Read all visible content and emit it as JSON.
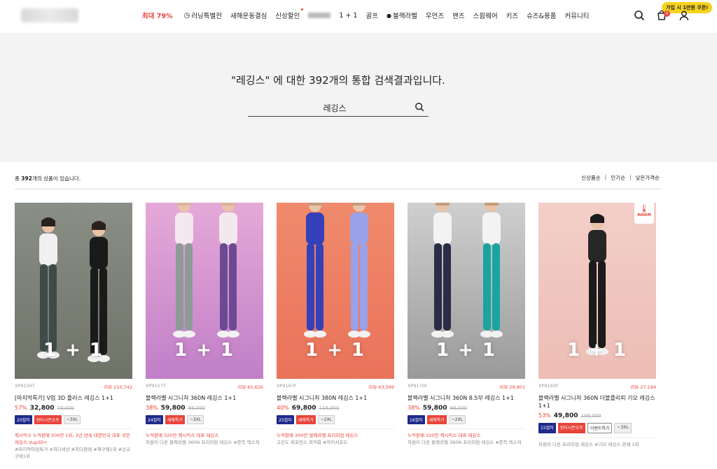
{
  "nav": {
    "items": [
      {
        "label": "최대 79%",
        "style": "sale"
      },
      {
        "label": "러닝특별전",
        "icon": "clock-icon"
      },
      {
        "label": "새해운동결심"
      },
      {
        "label": "신상할인",
        "dot": true
      },
      {
        "label": "",
        "style": "blurred"
      },
      {
        "label": "1 + 1"
      },
      {
        "label": "골프"
      },
      {
        "label": "블랙라벨",
        "icon": "globe-icon"
      },
      {
        "label": "우먼즈"
      },
      {
        "label": "맨즈"
      },
      {
        "label": "스윔웨어"
      },
      {
        "label": "키즈"
      },
      {
        "label": "슈즈&용품"
      },
      {
        "label": "커뮤니티"
      }
    ],
    "coupon_badge": "가입 시 1만원 쿠폰!",
    "cart_count": "0"
  },
  "search": {
    "title": "\"레깅스\" 에 대한 392개의 통합 검색결과입니다.",
    "value": "레깅스"
  },
  "results": {
    "prefix": "총 ",
    "count": "392",
    "suffix": "개의 상품이 있습니다.",
    "sort_options": [
      "신상품순",
      "인기순",
      "낮은가격순"
    ]
  },
  "products": [
    {
      "code": "XP9156T",
      "review": "리뷰 210,742",
      "name": "[마지막특가] V업 3D 플러스 레깅스 1+1",
      "discount": "57%",
      "price": "32,800",
      "original": "78,000",
      "badges": [
        {
          "text": "20컬러",
          "type": "color"
        },
        {
          "text": "윈터시즌오프",
          "type": "red"
        },
        {
          "text": "~3XL",
          "type": "gray"
        }
      ],
      "desc_highlight": "젝시믹스 누적판매 500만 1위, 3년 연속 대한민국 대표 국민레깅스 Vup3D+",
      "desc_gray": "#마지막타임특가 #최다색상 #최다판매 #재구매1위 #신규구매1위",
      "promo": "1 + 1",
      "bg": [
        "#8a8f86",
        "#6f7368"
      ]
    },
    {
      "code": "XP9157T",
      "review": "리뷰 65,626",
      "name": "블랙라벨 시그니처 360N 레깅스 1+1",
      "discount": "38%",
      "price": "59,800",
      "original": "98,000",
      "badges": [
        {
          "text": "24컬러",
          "type": "color"
        },
        {
          "text": "새해특가",
          "type": "red"
        },
        {
          "text": "~3XL",
          "type": "gray"
        }
      ],
      "desc_highlight": "누적판매 320만 젝시믹스 대표 레깅스",
      "desc_gray": "차원이 다른 블랙라벨 360N 프리미엄 레깅스 #쫀득 텍스처",
      "promo": "1 + 1",
      "bg": [
        "#e5a9d8",
        "#c17fc7"
      ]
    },
    {
      "code": "XP9167F",
      "review": "리뷰 63,569",
      "name": "블랙라벨 시그니처 380N 레깅스 1+1",
      "discount": "40%",
      "price": "69,800",
      "original": "118,000",
      "badges": [
        {
          "text": "25컬러",
          "type": "color"
        },
        {
          "text": "새해특가",
          "type": "red"
        },
        {
          "text": "~2XL",
          "type": "gray"
        }
      ],
      "desc_highlight": "누적판매 300만 블랙라벨 프리미엄 레깅스",
      "desc_gray": "고강도 퍼포먼스 최적화 #하이서포트",
      "promo": "1 + 1",
      "bg": [
        "#f08a6c",
        "#e9735a"
      ]
    },
    {
      "code": "XP9170F",
      "review": "리뷰 29,901",
      "name": "블랙라벨 시그니처 360N 8.5부 레깅스 1+1",
      "discount": "38%",
      "price": "59,800",
      "original": "98,000",
      "badges": [
        {
          "text": "16컬러",
          "type": "color"
        },
        {
          "text": "새해특가",
          "type": "red"
        },
        {
          "text": "~2XL",
          "type": "gray"
        }
      ],
      "desc_highlight": "누적판매 320만 젝시믹스 대표 레깅스",
      "desc_gray": "차원이 다른 블랙라벨 360N 프리미엄 레깅스 #쫀득 텍스처",
      "promo": "1 + 1",
      "bg": [
        "#cfcfcf",
        "#9a9a9a"
      ]
    },
    {
      "code": "XP9193F",
      "review": "리뷰 27,194",
      "name": "블랙라벨 시그니처 360N 더블플리피 기모 레깅스 1+1",
      "discount": "53%",
      "price": "49,800",
      "original": "108,000",
      "badges": [
        {
          "text": "15컬러",
          "type": "color"
        },
        {
          "text": "윈터시즌오프",
          "type": "red"
        },
        {
          "text": "이벤트특가",
          "type": "outline"
        },
        {
          "text": "~3XL",
          "type": "gray"
        }
      ],
      "desc_highlight": "",
      "desc_gray": "차원이 다른 프리미엄 레깅스 #기모 레깅스 판매 1위",
      "promo": "1 + 1",
      "warm": "WARM",
      "bg": [
        "#f3cfc8",
        "#ecbdb5"
      ]
    }
  ]
}
